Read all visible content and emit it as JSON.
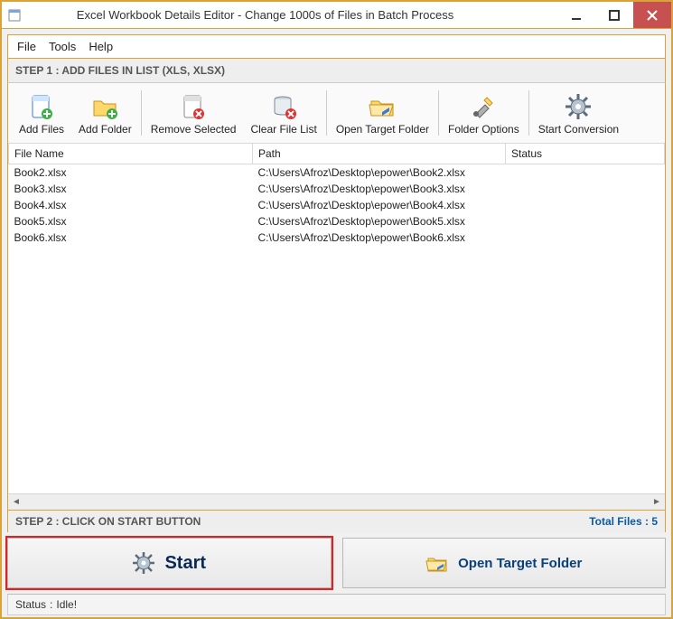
{
  "window": {
    "title": "Excel Workbook Details Editor - Change 1000s of Files in Batch Process"
  },
  "menubar": {
    "file": "File",
    "tools": "Tools",
    "help": "Help"
  },
  "step1_label": "STEP 1 : ADD FILES IN LIST (XLS, XLSX)",
  "toolbar": {
    "add_files": "Add Files",
    "add_folder": "Add Folder",
    "remove_selected": "Remove Selected",
    "clear_list": "Clear File List",
    "open_target": "Open Target Folder",
    "folder_options": "Folder Options",
    "start_conversion": "Start Conversion"
  },
  "grid": {
    "columns": {
      "file_name": "File Name",
      "path": "Path",
      "status": "Status"
    },
    "rows": [
      {
        "file_name": "Book2.xlsx",
        "path": "C:\\Users\\Afroz\\Desktop\\epower\\Book2.xlsx",
        "status": ""
      },
      {
        "file_name": "Book3.xlsx",
        "path": "C:\\Users\\Afroz\\Desktop\\epower\\Book3.xlsx",
        "status": ""
      },
      {
        "file_name": "Book4.xlsx",
        "path": "C:\\Users\\Afroz\\Desktop\\epower\\Book4.xlsx",
        "status": ""
      },
      {
        "file_name": "Book5.xlsx",
        "path": "C:\\Users\\Afroz\\Desktop\\epower\\Book5.xlsx",
        "status": ""
      },
      {
        "file_name": "Book6.xlsx",
        "path": "C:\\Users\\Afroz\\Desktop\\epower\\Book6.xlsx",
        "status": ""
      }
    ]
  },
  "step2_label": "STEP 2 : CLICK ON START BUTTON",
  "total_files_label": "Total Files : 5",
  "bottom": {
    "start": "Start",
    "open_target": "Open Target Folder"
  },
  "status": {
    "label": "Status",
    "sep": ":",
    "value": "Idle!"
  }
}
